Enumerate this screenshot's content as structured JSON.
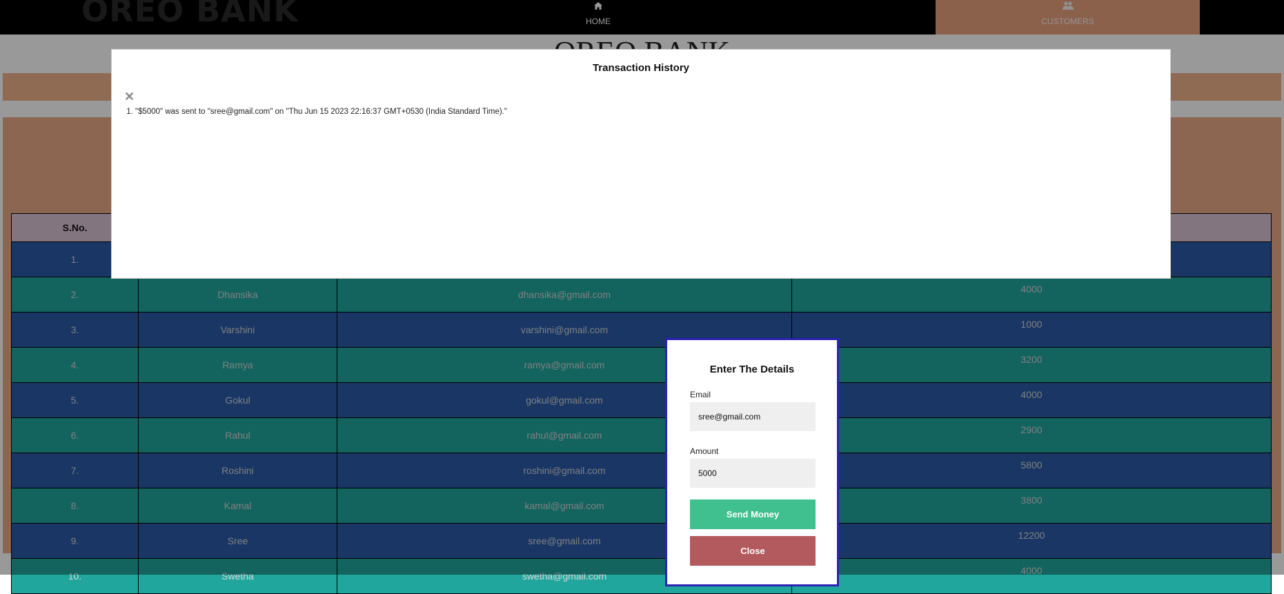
{
  "navbar": {
    "brand": "OREO BANK",
    "home": {
      "label": "HOME",
      "icon": "home-icon"
    },
    "customers": {
      "label": "CUSTOMERS",
      "icon": "users-icon"
    }
  },
  "page": {
    "heading": "OREO BANK"
  },
  "table": {
    "headers": [
      "S.No."
    ],
    "rows": [
      {
        "sno": "1.",
        "name": "",
        "email": "",
        "balance": ""
      },
      {
        "sno": "2.",
        "name": "Dhansika",
        "email": "dhansika@gmail.com",
        "balance": "4000"
      },
      {
        "sno": "3.",
        "name": "Varshini",
        "email": "varshini@gmail.com",
        "balance": "1000"
      },
      {
        "sno": "4.",
        "name": "Ramya",
        "email": "ramya@gmail.com",
        "balance": "3200"
      },
      {
        "sno": "5.",
        "name": "Gokul",
        "email": "gokul@gmail.com",
        "balance": "4000"
      },
      {
        "sno": "6.",
        "name": "Rahul",
        "email": "rahul@gmail.com",
        "balance": "2900"
      },
      {
        "sno": "7.",
        "name": "Roshini",
        "email": "roshini@gmail.com",
        "balance": "5800"
      },
      {
        "sno": "8.",
        "name": "Kamal",
        "email": "kamal@gmail.com",
        "balance": "3800"
      },
      {
        "sno": "9.",
        "name": "Sree",
        "email": "sree@gmail.com",
        "balance": "12200"
      },
      {
        "sno": "10.",
        "name": "Swetha",
        "email": "swetha@gmail.com",
        "balance": "4000"
      }
    ]
  },
  "history_modal": {
    "title": "Transaction History",
    "close_icon": "close-icon",
    "items": [
      "\"$5000\" was sent to \"sree@gmail.com\" on \"Thu Jun 15 2023 22:16:37 GMT+0530 (India Standard Time).\""
    ]
  },
  "send_modal": {
    "title": "Enter The Details",
    "email_label": "Email",
    "email_value": "sree@gmail.com",
    "amount_label": "Amount",
    "amount_value": "5000",
    "send_label": "Send Money",
    "close_label": "Close"
  },
  "colors": {
    "navbar_bg": "#000000",
    "customers_tab_bg": "#e8a27f",
    "row_blue": "#2a5aa8",
    "row_teal": "#21a69d",
    "send_button": "#3fc08e",
    "close_button": "#b35a5f",
    "modal_border": "#2c22b3"
  }
}
